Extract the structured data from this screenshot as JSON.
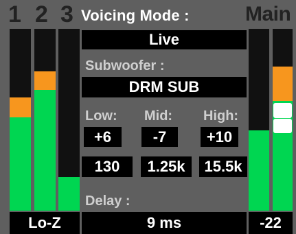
{
  "channels": {
    "ch1": "1",
    "ch2": "2",
    "ch3": "3",
    "main": "Main"
  },
  "voicing": {
    "label": "Voicing Mode :",
    "value": "Live"
  },
  "subwoofer": {
    "label": "Subwoofer :",
    "value": "DRM SUB"
  },
  "eq": {
    "low": {
      "label": "Low:",
      "gain": "+6",
      "freq": "130"
    },
    "mid": {
      "label": "Mid:",
      "gain": "-7",
      "freq": "1.25k"
    },
    "high": {
      "label": "High:",
      "gain": "+10",
      "freq": "15.5k"
    }
  },
  "delay": {
    "label": "Delay :",
    "value": "9 ms"
  },
  "input_mode": "Lo-Z",
  "main_level": "-22",
  "meters": {
    "ch1": {
      "level": 0.62,
      "peak_segment": 0.11
    },
    "ch2": {
      "level": 0.77,
      "peak_segment": 0.1
    },
    "ch3": {
      "level": 0.18,
      "peak_segment": 0.0
    },
    "main_left": {
      "level": 0.44,
      "peak_segment": 0.0
    },
    "main_right": {
      "level": 0.79,
      "peak_segment": 0.19
    }
  },
  "colors": {
    "meter_green": "#00d651",
    "meter_orange": "#f7961e",
    "background": "#5f5f5f"
  }
}
